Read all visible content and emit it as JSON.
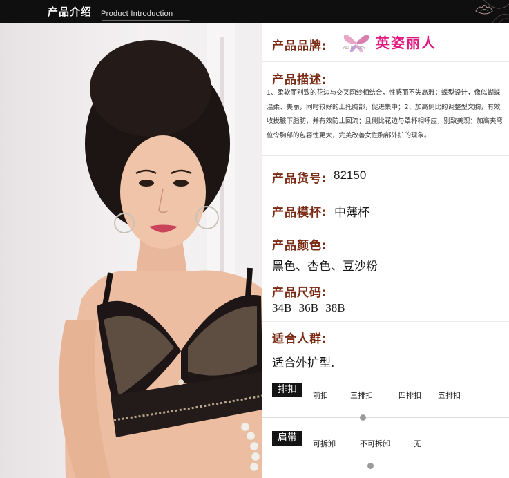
{
  "header": {
    "title_zh": "产品介绍",
    "title_en": "Product Introduction"
  },
  "brand": {
    "label": "产品品牌:",
    "logo_sub": "Y&Z BEAUTY",
    "name": "英姿丽人",
    "color": "#e0187f"
  },
  "description": {
    "label": "产品描述:",
    "text": "1、柔软而别致的花边与交叉网纱相结合，性感而不失高雅；蝶型设计，像似蝴蝶温柔、美丽，同时较好的上托胸部，促进集中；2、加高侧比的调整型文胸，有效收拢腋下脂肪，并有效防止回流；且侧比花边与罩杯相呼应，别致美观；加高夹弯位令胸部的包容性更大，完美改善女性胸部外扩的现象。"
  },
  "item_no": {
    "label": "产品货号:",
    "value": "82150"
  },
  "cup": {
    "label": "产品模杯:",
    "value": "中薄杯"
  },
  "colors": {
    "label": "产品颜色:",
    "value": "黑色、杏色、豆沙粉"
  },
  "sizes": {
    "label": "产品尺码:",
    "values": [
      "34B",
      "36B",
      "38B"
    ]
  },
  "fit": {
    "label": "适合人群:",
    "value": "适合外扩型."
  },
  "hooks": {
    "tag": "排扣",
    "options": [
      "前扣",
      "三排扣",
      "四排扣",
      "五排扣"
    ],
    "selected_index": 1
  },
  "straps": {
    "tag": "肩带",
    "options": [
      "可拆卸",
      "不可拆卸",
      "无"
    ],
    "selected_index": 1
  },
  "palette": {
    "label_color": "#7a2a12",
    "header_bg": "#0f0f0f"
  }
}
